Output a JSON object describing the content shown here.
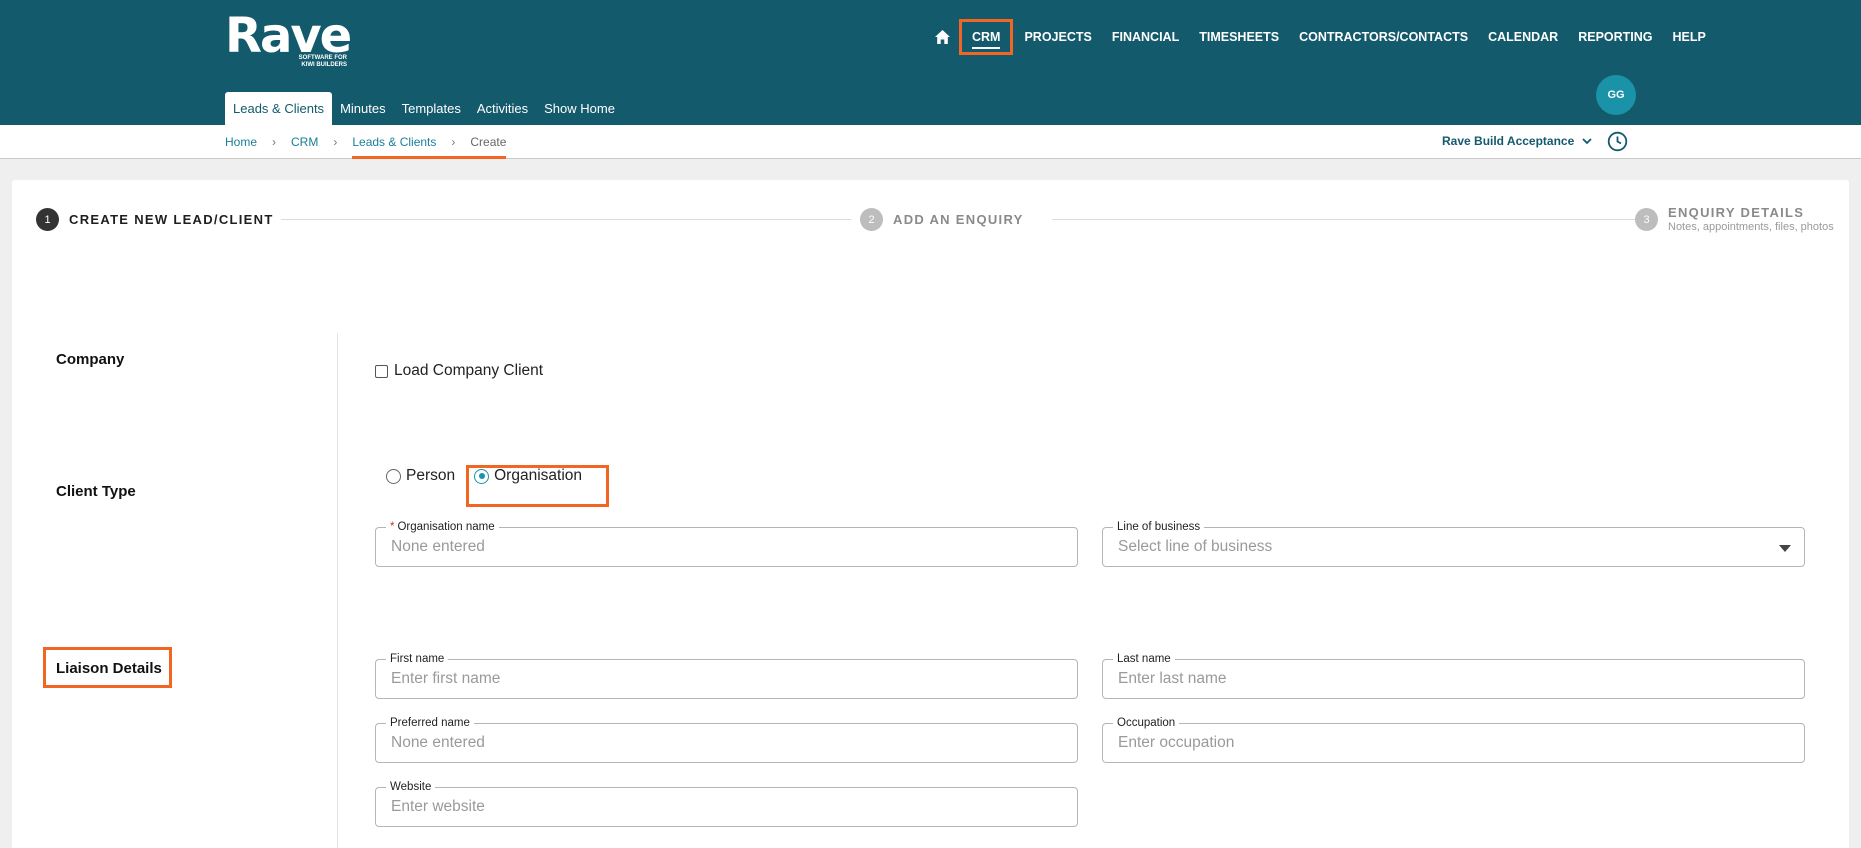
{
  "brand": {
    "name": "Rave",
    "tagline": "SOFTWARE FOR\nKIWI BUILDERS"
  },
  "nav": {
    "items": [
      "CRM",
      "PROJECTS",
      "FINANCIAL",
      "TIMESHEETS",
      "CONTRACTORS/CONTACTS",
      "CALENDAR",
      "REPORTING",
      "HELP"
    ],
    "home_icon": "home-icon",
    "user_initials": "GG"
  },
  "subnav": [
    "Leads & Clients",
    "Minutes",
    "Templates",
    "Activities",
    "Show Home"
  ],
  "breadcrumb": [
    "Home",
    "CRM",
    "Leads & Clients",
    "Create"
  ],
  "company_selector": "Rave Build Acceptance",
  "stepper": {
    "steps": [
      {
        "num": "1",
        "label": "CREATE NEW LEAD/CLIENT",
        "sub": ""
      },
      {
        "num": "2",
        "label": "ADD AN ENQUIRY",
        "sub": ""
      },
      {
        "num": "3",
        "label": "ENQUIRY DETAILS",
        "sub": "Notes, appointments, files, photos"
      }
    ]
  },
  "form": {
    "company_label": "Company",
    "load_company_client": "Load Company Client",
    "client_type_label": "Client Type",
    "client_types": [
      "Person",
      "Organisation"
    ],
    "selected_client_type": "Organisation",
    "org_name": {
      "label": "Organisation name",
      "placeholder": "None entered",
      "required": true
    },
    "line_of_business": {
      "label": "Line of business",
      "placeholder": "Select line of business"
    },
    "liaison_label": "Liaison Details",
    "first_name": {
      "label": "First name",
      "placeholder": "Enter first name"
    },
    "last_name": {
      "label": "Last name",
      "placeholder": "Enter last name"
    },
    "preferred_name": {
      "label": "Preferred name",
      "placeholder": "None entered"
    },
    "occupation": {
      "label": "Occupation",
      "placeholder": "Enter occupation"
    },
    "website": {
      "label": "Website",
      "placeholder": "Enter website"
    }
  },
  "colors": {
    "header": "#135a6c",
    "accent": "#1a93a8",
    "highlight": "#f26522"
  }
}
